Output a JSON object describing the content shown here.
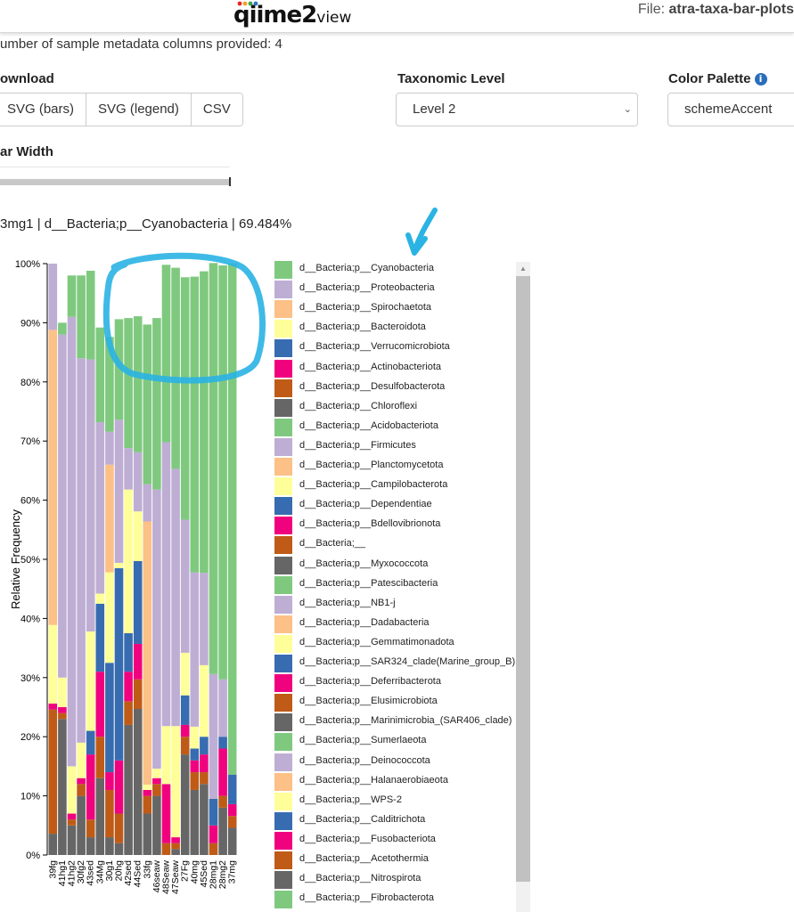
{
  "header": {
    "logo_text": "qiime2",
    "logo_suffix": "view",
    "file_label": "File:",
    "file_name": "atra-taxa-bar-plots"
  },
  "meta_text": "umber of sample metadata columns provided: 4",
  "download": {
    "label": "ownload",
    "buttons": [
      "SVG (bars)",
      "SVG (legend)",
      "CSV"
    ]
  },
  "taxonomic_level": {
    "label": "Taxonomic Level",
    "selected": "Level 2"
  },
  "color_palette": {
    "label": "Color Palette",
    "selected": "schemeAccent",
    "info_icon": "info-icon"
  },
  "bar_width": {
    "label": "ar Width"
  },
  "hover_text": "3mg1 | d__Bacteria;p__Cyanobacteria | 69.484%",
  "colors": {
    "palette": [
      "#7fc97f",
      "#beaed4",
      "#fdc086",
      "#ffff99",
      "#386cb0",
      "#f0027f",
      "#bf5b17",
      "#666666"
    ],
    "annotation": "#2ab3e3"
  },
  "chart_data": {
    "type": "bar",
    "stacked": true,
    "ylabel": "Relative Frequency",
    "ylim": [
      0,
      100
    ],
    "yticks": [
      "0%",
      "10%",
      "20%",
      "30%",
      "40%",
      "50%",
      "60%",
      "70%",
      "80%",
      "90%",
      "100%"
    ],
    "categories": [
      "39fg",
      "41hg1",
      "41hg2",
      "30fg2",
      "43sed",
      "34Mg",
      "30g1",
      "20hg",
      "42sed",
      "44Sed",
      "33fg",
      "46seaw",
      "48Seaw",
      "47Seaw",
      "27Fg",
      "40mg",
      "45Sed",
      "28mg1",
      "28mg2",
      "37mg"
    ],
    "series": [
      {
        "name": "d__Bacteria;p__Cyanobacteria",
        "values": [
          0,
          2,
          7,
          14,
          15,
          16,
          16,
          17,
          22,
          23,
          27,
          29,
          30,
          34,
          41,
          50,
          51,
          69.5,
          70,
          86.4
        ]
      },
      {
        "name": "d__Bacteria;p__Proteobacteria",
        "values": [
          11.2,
          58,
          76,
          65,
          46,
          29,
          5.6,
          24.2,
          7,
          10,
          6.3,
          47.2,
          48,
          43.5,
          22.5,
          26.1,
          15.6,
          21.1,
          9.7,
          0
        ]
      },
      {
        "name": "d__Bacteria;p__Spirochaetota",
        "values": [
          49.9,
          0,
          0,
          0,
          0,
          0,
          18.2,
          0,
          0,
          0,
          44.5,
          0,
          0,
          0,
          0,
          0,
          0,
          0,
          0,
          0
        ]
      },
      {
        "name": "d__Bacteria;p__Bacteroidota",
        "values": [
          13.3,
          5,
          8,
          6,
          16.8,
          1.7,
          15.3,
          0.9,
          24.3,
          8.4,
          0.9,
          1.6,
          9.8,
          18.8,
          7.2,
          3.7,
          12.1,
          0,
          0,
          0
        ]
      },
      {
        "name": "d__Bacteria;p__Verrucomicrobiota",
        "values": [
          0,
          0,
          0,
          0,
          4,
          11.5,
          18.5,
          32.5,
          6.5,
          14,
          0,
          0,
          0,
          0,
          5,
          2,
          3,
          4.5,
          2,
          5
        ]
      },
      {
        "name": "d__Bacteria;p__Actinobacteriota",
        "values": [
          1,
          1,
          1,
          1,
          11,
          11,
          3,
          9,
          5,
          6,
          1,
          1,
          10,
          1,
          2,
          2,
          3,
          3,
          8,
          2
        ]
      },
      {
        "name": "d__Bacteria;p__Desulfobacterota",
        "values": [
          21,
          1,
          1,
          2,
          3,
          7,
          8,
          5,
          4,
          5,
          3,
          2,
          2,
          1,
          3,
          3,
          2,
          2,
          2,
          2
        ]
      },
      {
        "name": "d__Bacteria;p__Chloroflexi",
        "values": [
          3.6,
          23,
          5,
          10,
          3,
          13,
          3,
          2,
          22,
          24.7,
          7,
          10,
          0,
          1,
          17,
          11,
          12,
          0,
          8,
          4.6
        ]
      }
    ]
  },
  "legend": [
    "d__Bacteria;p__Cyanobacteria",
    "d__Bacteria;p__Proteobacteria",
    "d__Bacteria;p__Spirochaetota",
    "d__Bacteria;p__Bacteroidota",
    "d__Bacteria;p__Verrucomicrobiota",
    "d__Bacteria;p__Actinobacteriota",
    "d__Bacteria;p__Desulfobacterota",
    "d__Bacteria;p__Chloroflexi",
    "d__Bacteria;p__Acidobacteriota",
    "d__Bacteria;p__Firmicutes",
    "d__Bacteria;p__Planctomycetota",
    "d__Bacteria;p__Campilobacterota",
    "d__Bacteria;p__Dependentiae",
    "d__Bacteria;p__Bdellovibrionota",
    "d__Bacteria;__",
    "d__Bacteria;p__Myxococcota",
    "d__Bacteria;p__Patescibacteria",
    "d__Bacteria;p__NB1-j",
    "d__Bacteria;p__Dadabacteria",
    "d__Bacteria;p__Gemmatimonadota",
    "d__Bacteria;p__SAR324_clade(Marine_group_B)",
    "d__Bacteria;p__Deferribacterota",
    "d__Bacteria;p__Elusimicrobiota",
    "d__Bacteria;p__Marinimicrobia_(SAR406_clade)",
    "d__Bacteria;p__Sumerlaeota",
    "d__Bacteria;p__Deinococcota",
    "d__Bacteria;p__Halanaerobiaeota",
    "d__Bacteria;p__WPS-2",
    "d__Bacteria;p__Calditrichota",
    "d__Bacteria;p__Fusobacteriota",
    "d__Bacteria;p__Acetothermia",
    "d__Bacteria;p__Nitrospirota",
    "d__Bacteria;p__Fibrobacterota"
  ]
}
